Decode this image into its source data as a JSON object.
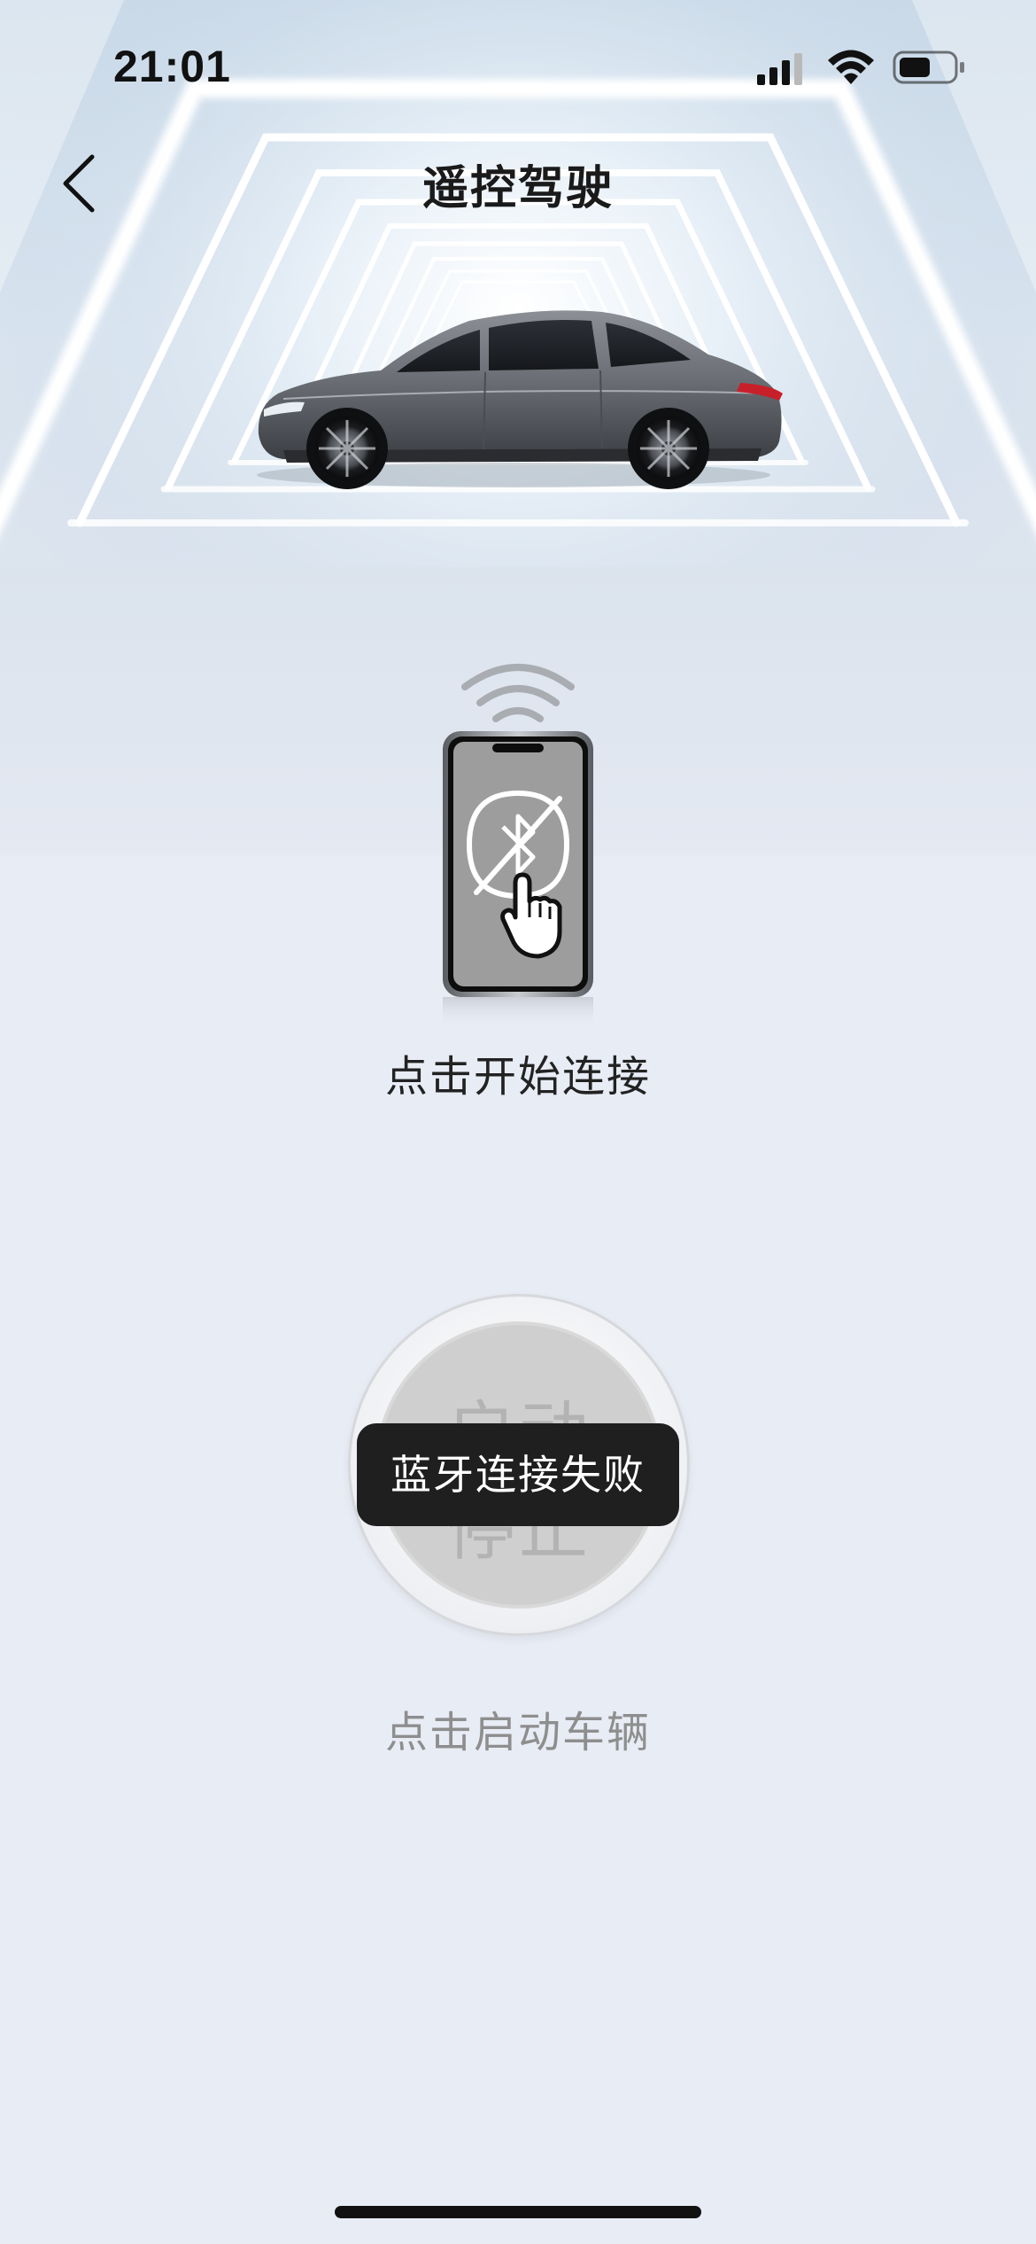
{
  "status_bar": {
    "time": "21:01",
    "icons": [
      "signal-icon",
      "wifi-icon",
      "battery-icon"
    ]
  },
  "nav": {
    "title": "遥控驾驶",
    "back_icon": "chevron-left-icon"
  },
  "hero": {
    "image": "car-image",
    "background": "light-tunnel"
  },
  "connect": {
    "icon": "bluetooth-disabled-phone-icon",
    "label": "点击开始连接"
  },
  "start_stop": {
    "start_label": "启动",
    "stop_label": "停止",
    "caption": "点击启动车辆"
  },
  "toast": {
    "message": "蓝牙连接失败"
  },
  "colors": {
    "page_background": "#e8ecf5",
    "toast_background": "#1f1f1f",
    "title_text": "#1a1a1a",
    "muted_text": "#8e8e8e"
  }
}
